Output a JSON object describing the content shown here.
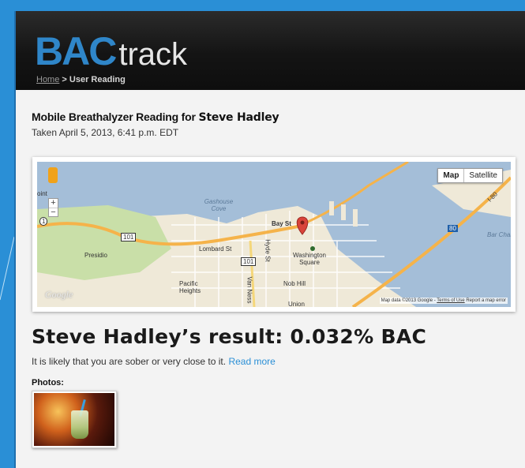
{
  "header": {
    "logo_primary": "BAC",
    "logo_secondary": "track",
    "breadcrumb_home": "Home",
    "breadcrumb_separator": ">",
    "breadcrumb_current": "User Reading"
  },
  "reading": {
    "title_prefix": "Mobile Breathalyzer Reading for",
    "user_name": "Steve Hadley",
    "taken": "Taken April 5, 2013, 6:41 p.m. EDT"
  },
  "map": {
    "type_buttons": [
      "Map",
      "Satellite"
    ],
    "active_type": "Map",
    "zoom_in": "+",
    "zoom_out": "−",
    "labels": {
      "gashouse_cove": "Gashouse Cove",
      "bay_st": "Bay St",
      "lombard_st": "Lombard St",
      "washington_square": "Washington Square",
      "presidio": "Presidio",
      "pacific_heights": "Pacific Heights",
      "nob_hill": "Nob Hill",
      "union": "Union",
      "hyde_st": "Hyde St",
      "van_ness": "Van Ness",
      "point": "oint",
      "bar_chan": "Bar Chan",
      "route_101a": "101",
      "route_101b": "101",
      "route_1": "1",
      "route_80": "80",
      "i80": "I-80"
    },
    "google_logo": "Google",
    "attribution_data": "Map data ©2013 Google",
    "attribution_tou": "Terms of Use",
    "attribution_report": "Report a map error"
  },
  "result": {
    "text": "Steve Hadley’s result: 0.032% BAC",
    "description": "It is likely that you are sober or very close to it.",
    "read_more": "Read more"
  },
  "photos": {
    "label": "Photos:"
  },
  "colors": {
    "brand_blue": "#2f86c9",
    "background_blue": "#2a8fd6",
    "header_dark": "#141414",
    "link": "#2a8fd6"
  }
}
